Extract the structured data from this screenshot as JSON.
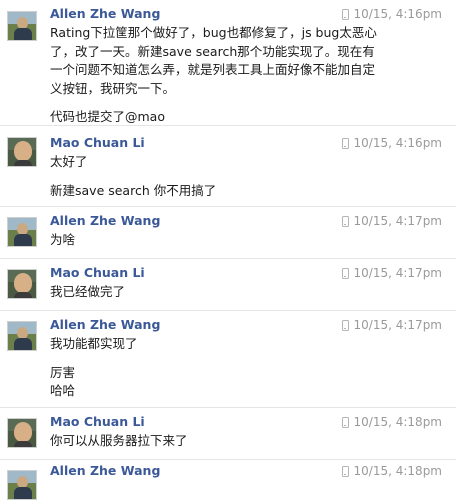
{
  "messages": [
    {
      "sender": "Allen Zhe Wang",
      "avatar": "allen",
      "time": "10/15, 4:16pm",
      "source_icon": "mobile-phone-icon",
      "lines": [
        "Rating下拉筐那个做好了，bug也都修复了，js bug太恶心",
        "了，改了一天。新建save search那个功能实现了。现在有",
        "一个问题不知道怎么弄，就是列表工具上面好像不能加自定",
        "义按钮，我研究一下。",
        "",
        "代码也提交了@mao"
      ]
    },
    {
      "sender": "Mao Chuan Li",
      "avatar": "mao",
      "time": "10/15, 4:16pm",
      "source_icon": "mobile-phone-icon",
      "lines": [
        "太好了",
        "",
        "新建save search 你不用搞了"
      ]
    },
    {
      "sender": "Allen Zhe Wang",
      "avatar": "allen",
      "time": "10/15, 4:17pm",
      "source_icon": "mobile-phone-icon",
      "lines": [
        "为啥"
      ]
    },
    {
      "sender": "Mao Chuan Li",
      "avatar": "mao",
      "time": "10/15, 4:17pm",
      "source_icon": "mobile-phone-icon",
      "lines": [
        "我已经做完了"
      ]
    },
    {
      "sender": "Allen Zhe Wang",
      "avatar": "allen",
      "time": "10/15, 4:17pm",
      "source_icon": "mobile-phone-icon",
      "lines": [
        "我功能都实现了",
        "",
        "厉害",
        "哈哈"
      ]
    },
    {
      "sender": "Mao Chuan Li",
      "avatar": "mao",
      "time": "10/15, 4:18pm",
      "source_icon": "mobile-phone-icon",
      "lines": [
        "你可以从服务器拉下来了"
      ]
    },
    {
      "sender": "Allen Zhe Wang",
      "avatar": "allen",
      "time": "10/15, 4:18pm",
      "source_icon": "mobile-phone-icon",
      "lines": []
    }
  ]
}
